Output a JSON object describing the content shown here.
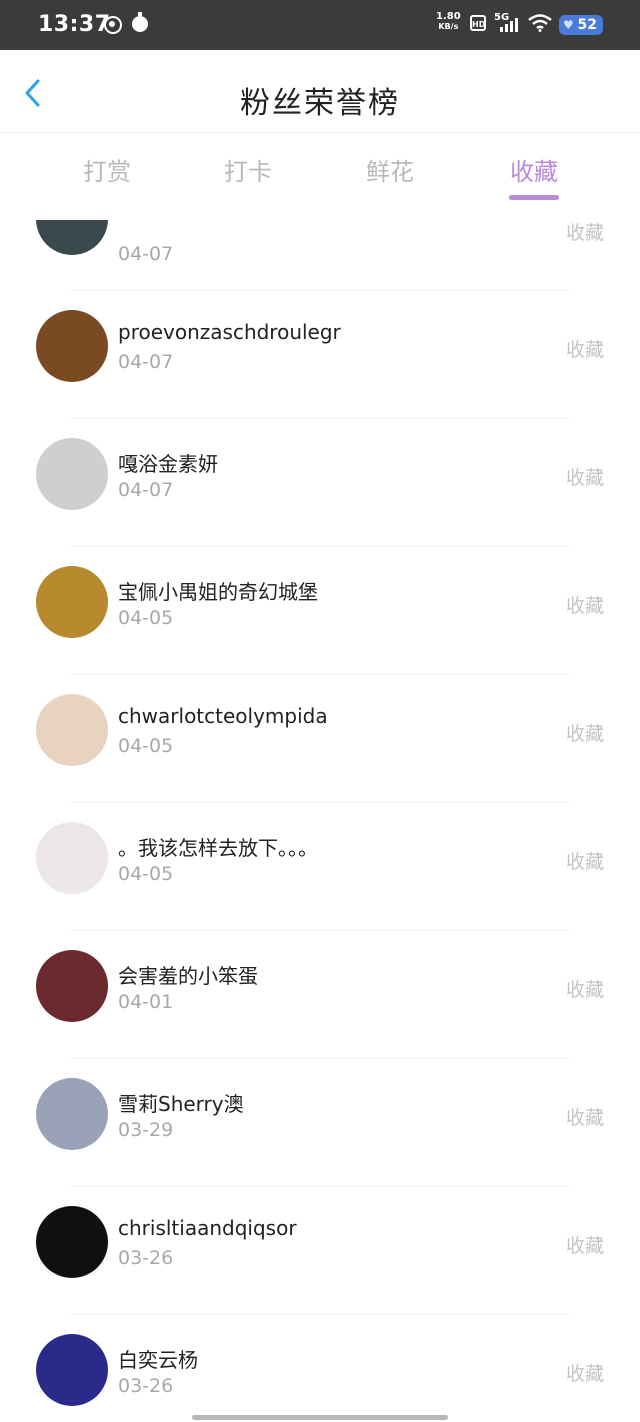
{
  "status_bar": {
    "time": "13:37",
    "net_speed_value": "1.80",
    "net_speed_unit": "KB/s",
    "hd": "HD",
    "network": "5G",
    "battery": "52"
  },
  "header": {
    "title": "粉丝荣誉榜",
    "back_icon": "chevron-left-icon"
  },
  "tabs": [
    {
      "label": "打赏",
      "active": false
    },
    {
      "label": "打卡",
      "active": false
    },
    {
      "label": "鲜花",
      "active": false
    },
    {
      "label": "收藏",
      "active": true
    }
  ],
  "list": {
    "items": [
      {
        "name": "",
        "date": "04-07",
        "action": "收藏",
        "avatar_color": "#3a4a4c"
      },
      {
        "name": "proevonzaschdroulegr",
        "date": "04-07",
        "action": "收藏",
        "avatar_color": "#7a4a22"
      },
      {
        "name": "嘎浴金素妍",
        "date": "04-07",
        "action": "收藏",
        "avatar_color": "#cfcfcf"
      },
      {
        "name": "宝佩小禺姐的奇幻城堡",
        "date": "04-05",
        "action": "收藏",
        "avatar_color": "#b88a2e"
      },
      {
        "name": "chwarlotcteolympida",
        "date": "04-05",
        "action": "收藏",
        "avatar_color": "#e8d2c0"
      },
      {
        "name": "。我该怎样去放下。。。",
        "date": "04-05",
        "action": "收藏",
        "avatar_color": "#ece6ea"
      },
      {
        "name": "会害羞的小笨蛋",
        "date": "04-01",
        "action": "收藏",
        "avatar_color": "#6b2a2e"
      },
      {
        "name": "雪莉Sherry澳",
        "date": "03-29",
        "action": "收藏",
        "avatar_color": "#9aa2b8"
      },
      {
        "name": "chrisltiaandqiqsor",
        "date": "03-26",
        "action": "收藏",
        "avatar_color": "#101010"
      },
      {
        "name": "白奕云杨",
        "date": "03-26",
        "action": "收藏",
        "avatar_color": "#2a2a8a"
      }
    ]
  }
}
